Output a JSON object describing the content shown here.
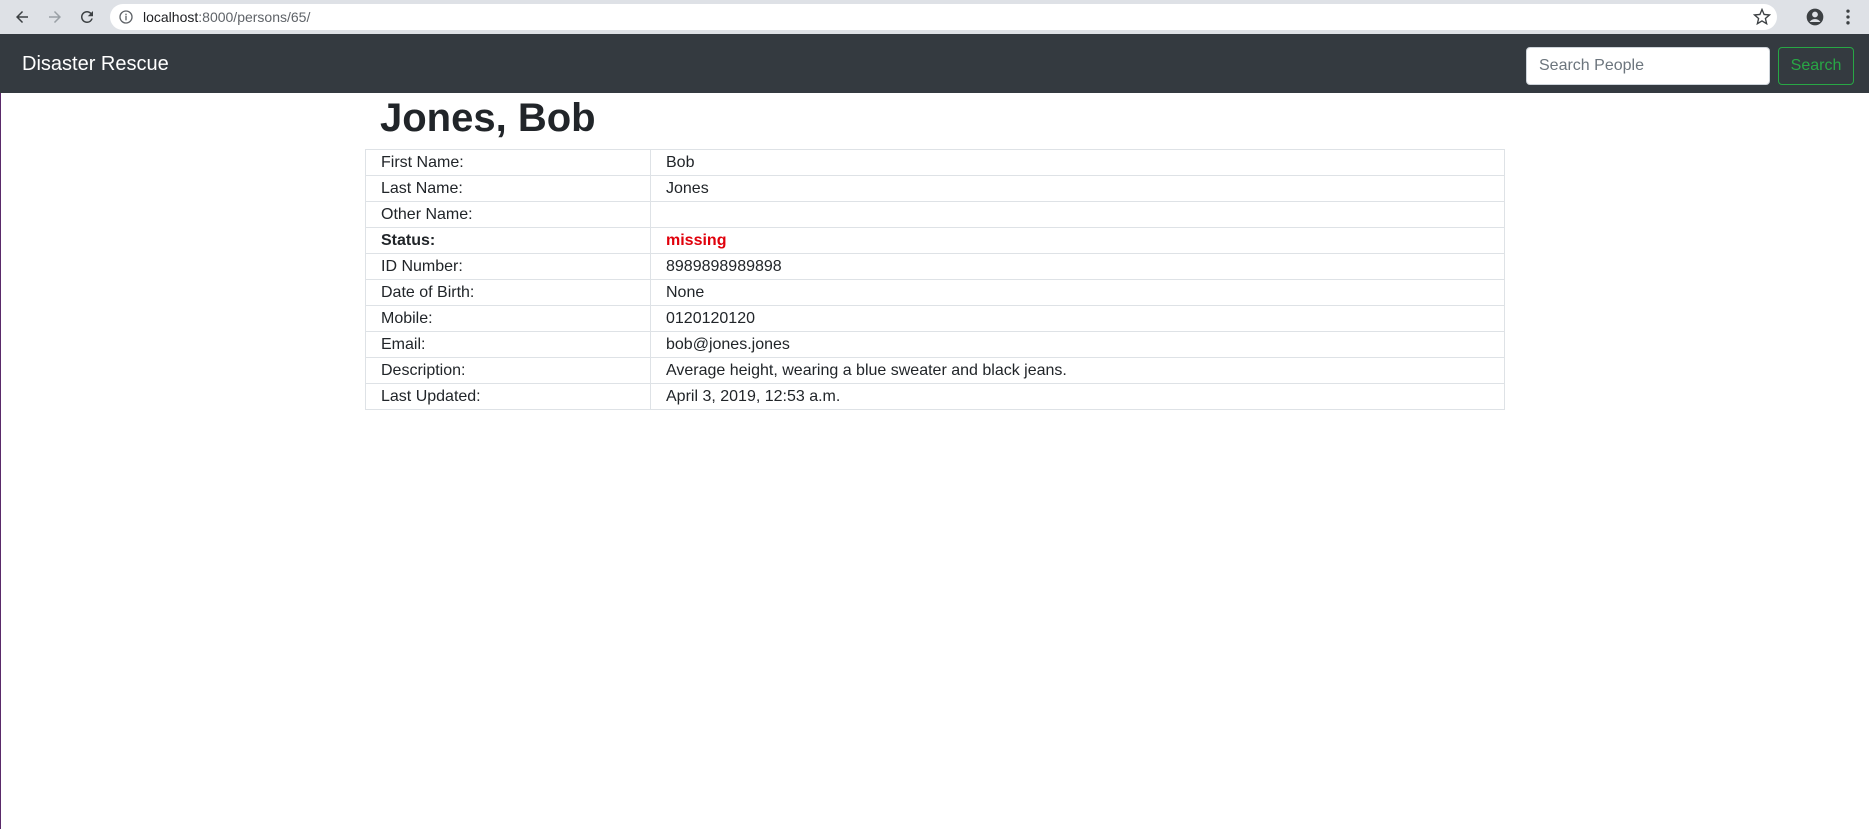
{
  "browser": {
    "url_host": "localhost",
    "url_path": ":8000/persons/65/"
  },
  "navbar": {
    "brand": "Disaster Rescue",
    "search_placeholder": "Search People",
    "search_button": "Search"
  },
  "page": {
    "title": "Jones, Bob"
  },
  "details": [
    {
      "label": "First Name:",
      "value": "Bob"
    },
    {
      "label": "Last Name:",
      "value": "Jones"
    },
    {
      "label": "Other Name:",
      "value": ""
    },
    {
      "label": "Status:",
      "value": "missing"
    },
    {
      "label": "ID Number:",
      "value": "8989898989898"
    },
    {
      "label": "Date of Birth:",
      "value": "None"
    },
    {
      "label": "Mobile:",
      "value": "0120120120"
    },
    {
      "label": "Email:",
      "value": "bob@jones.jones"
    },
    {
      "label": "Description:",
      "value": "Average height, wearing a blue sweater and black jeans."
    },
    {
      "label": "Last Updated:",
      "value": "April 3, 2019, 12:53 a.m."
    }
  ],
  "colors": {
    "navbar_bg": "#343a40",
    "status_missing": "#e0000b",
    "search_button": "#28a745"
  }
}
